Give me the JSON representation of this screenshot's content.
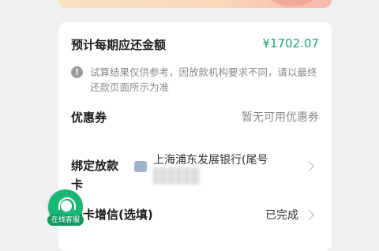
{
  "repayment": {
    "label": "预计每期应还金额",
    "amount": "¥1702.07",
    "notice": "试算结果仅供参考，因放款机构要求不同，请以最终还款页面所示为准"
  },
  "coupon": {
    "label": "优惠券",
    "value": "暂无可用优惠券"
  },
  "bind_card": {
    "label": "绑定放款卡",
    "bank_name": "上海浦东发展银行(尾号"
  },
  "credit_card": {
    "label_visible": "用卡增信(选填)",
    "status": "已完成"
  },
  "customer_service": {
    "label": "在线客服"
  },
  "colors": {
    "accent_green": "#1aa56f",
    "cs_green": "#17b877",
    "text_muted": "#8a8a8a"
  }
}
